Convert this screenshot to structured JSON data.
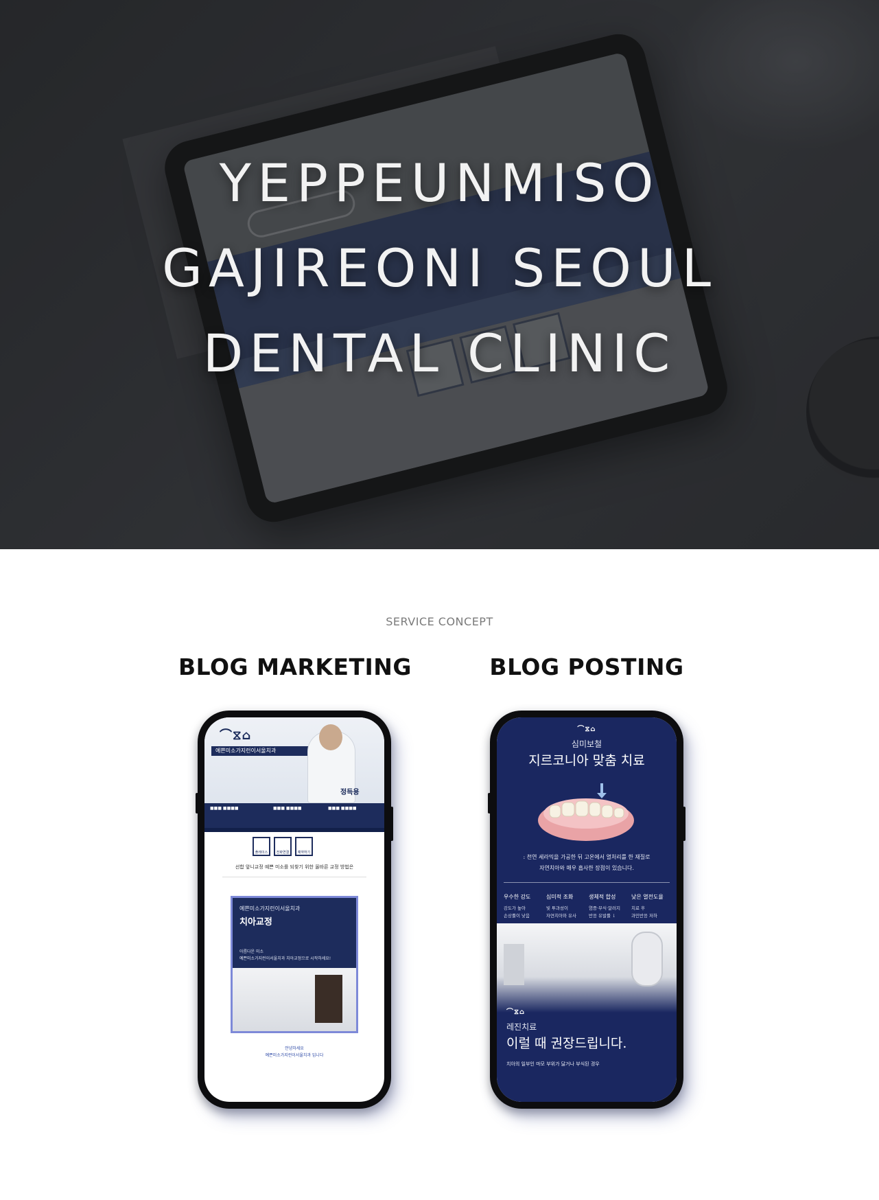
{
  "hero": {
    "title_lines": [
      "YEPPEUNMISO",
      "GAJIREONI SEOUL",
      "DENTAL CLINIC"
    ]
  },
  "service": {
    "label": "SERVICE CONCEPT",
    "left_title": "BLOG MARKETING",
    "right_title": "BLOG POSTING"
  },
  "blog_marketing": {
    "clinic_name": "예쁜미소가지런이서울치과",
    "ceo": "정득용",
    "icons": [
      "플레이스",
      "전화연결",
      "예약하기"
    ],
    "subtitle": "선합 앞니교정 예쁜 미소를 되찾기 위한 올바른 교정 방법은",
    "card_small": "예쁜미소가지런이서울치과",
    "card_title": "치아교정",
    "card_body_1": "아름다운 미소",
    "card_body_2": "예쁜미소가지런이서울치과 치아교정으로 시작하세요!",
    "footer_1": "안녕하세요",
    "footer_2": "예쁜미소가지런이서울치과 입니다"
  },
  "blog_posting": {
    "category": "심미보철",
    "title": "지르코니아 맞춤 치료",
    "desc_1": ": 천연 세라믹을 가공한 뒤 고온에서 열처리를 한 재질로",
    "desc_2": "자연치아와 매우 흡사한 장점이 있습니다.",
    "features": [
      {
        "name": "우수한 강도",
        "d1": "강도가 높아",
        "d2": "손상률이 낮음"
      },
      {
        "name": "심미적 조화",
        "d1": "빛 투과성이",
        "d2": "자연치아와 유사"
      },
      {
        "name": "생체적 합성",
        "d1": "염증·부식·알러지",
        "d2": "반응 유발률 ↓"
      },
      {
        "name": "낮은 열전도율",
        "d1": "치료 후",
        "d2": "과민반응 저하"
      }
    ],
    "category_2": "레진치료",
    "title_2": "이럴 때 권장드립니다.",
    "bottom_text": "치아의 일부인 마모 부위가 닳거나 부식된 경우"
  }
}
